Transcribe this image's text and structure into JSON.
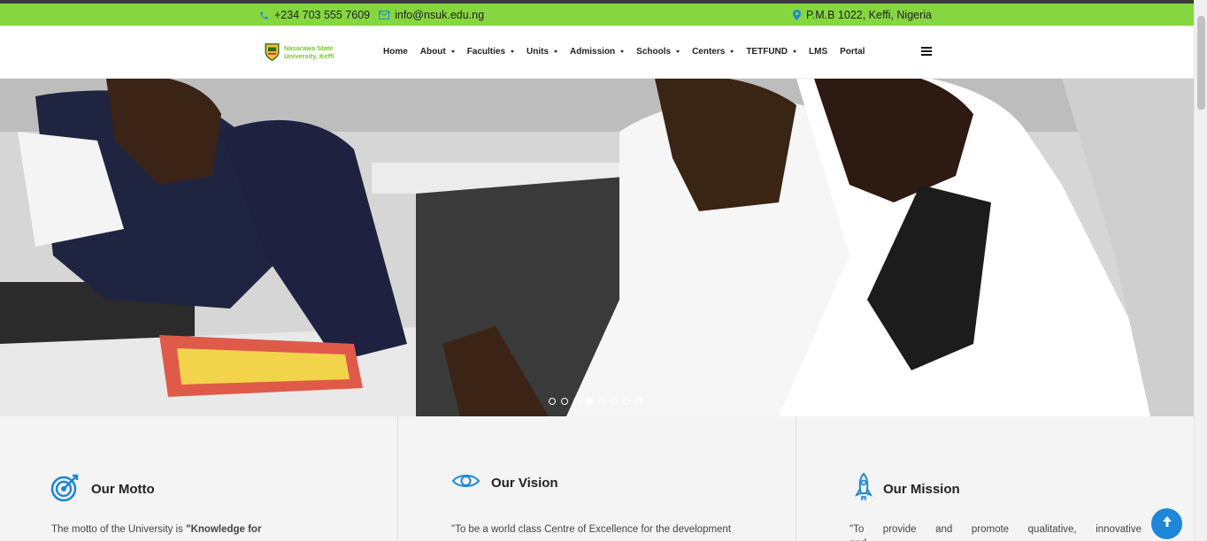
{
  "topbar": {
    "phone": "+234 703 555 7609",
    "email": "info@nsuk.edu.ng",
    "address": "P.M.B 1022, Keffi, Nigeria",
    "icon_color": "#1e87d8",
    "bg_color": "#86d73f"
  },
  "logo": {
    "line1": "Nasarawa State",
    "line2": "University, Keffi"
  },
  "nav": {
    "items": [
      {
        "label": "Home",
        "dropdown": false
      },
      {
        "label": "About",
        "dropdown": true
      },
      {
        "label": "Faculties",
        "dropdown": true
      },
      {
        "label": "Units",
        "dropdown": true
      },
      {
        "label": "Admission",
        "dropdown": true
      },
      {
        "label": "Schools",
        "dropdown": true
      },
      {
        "label": "Centers",
        "dropdown": true
      },
      {
        "label": "TETFUND",
        "dropdown": true
      },
      {
        "label": "LMS",
        "dropdown": false
      },
      {
        "label": "Portal",
        "dropdown": false
      }
    ]
  },
  "slider": {
    "slide_count": 8,
    "active_index": 3
  },
  "features": {
    "motto": {
      "title": "Our Motto",
      "text_prefix": "The motto of the University is ",
      "text_bold": "\"Knowledge for",
      "icon": "target-icon"
    },
    "vision": {
      "title": "Our Vision",
      "text": "\"To be a world class Centre of Excellence for the development",
      "icon": "eye-icon"
    },
    "mission": {
      "title": "Our Mission",
      "text": "\"To provide and promote qualitative, innovative and",
      "icon": "rocket-icon"
    },
    "accent_color": "#1e87d8"
  }
}
